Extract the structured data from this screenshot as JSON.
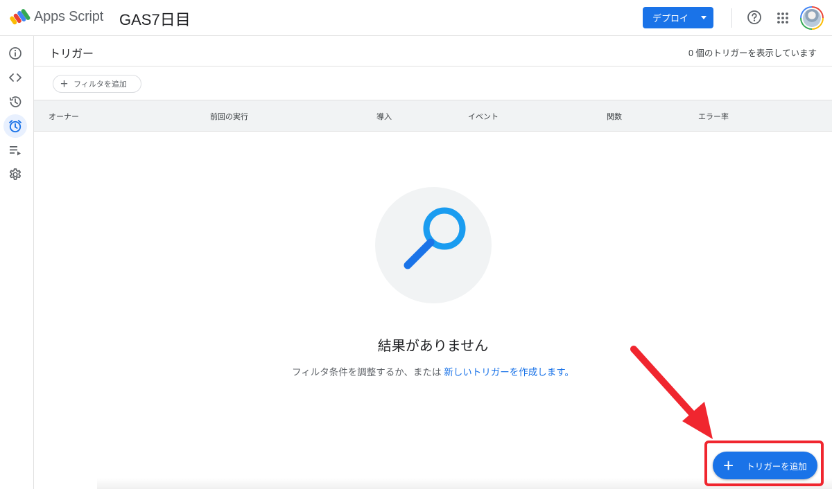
{
  "header": {
    "app_name": "Apps Script",
    "project_name": "GAS7日目",
    "deploy_label": "デプロイ",
    "icons": [
      "apps-script-logo",
      "help-icon",
      "apps-grid-icon",
      "avatar"
    ]
  },
  "sidebar": {
    "items": [
      {
        "name": "overview",
        "icon": "info-icon",
        "active": false
      },
      {
        "name": "editor",
        "icon": "code-icon",
        "active": false
      },
      {
        "name": "executions-history",
        "icon": "history-icon",
        "active": false
      },
      {
        "name": "triggers",
        "icon": "alarm-icon",
        "active": true
      },
      {
        "name": "executions",
        "icon": "list-play-icon",
        "active": false
      },
      {
        "name": "settings",
        "icon": "gear-icon",
        "active": false
      }
    ]
  },
  "main": {
    "title": "トリガー",
    "count_text": "0 個のトリガーを表示しています",
    "filter_label": "フィルタを追加",
    "columns": [
      "オーナー",
      "前回の実行",
      "導入",
      "イベント",
      "関数",
      "エラー率"
    ],
    "empty_title": "結果がありません",
    "empty_sub_prefix": "フィルタ条件を調整するか、または",
    "empty_sub_link": "新しいトリガーを作成します。"
  },
  "fab": {
    "label": "トリガーを追加"
  },
  "colors": {
    "primary": "#1a73e8",
    "annotation_red": "#f0262f",
    "active_nav_bg": "#e8f0fe",
    "search_icon": "#1a9cf0"
  }
}
